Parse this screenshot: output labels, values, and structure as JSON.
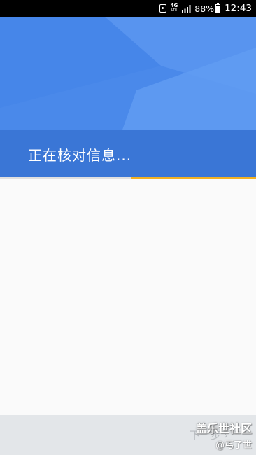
{
  "status_bar": {
    "network": "4G",
    "network_sub": "LTE",
    "battery_percent": "88%",
    "battery_level": 0.88,
    "time": "12:43"
  },
  "header": {
    "title": "正在核对信息...",
    "progress": 0.48
  },
  "footer": {
    "next_label": "下一步"
  },
  "watermark": {
    "line1": "盖乐世社区",
    "line2": "@丐了世"
  },
  "colors": {
    "header_blue": "#4a89ea",
    "title_band_blue": "#3a76d6",
    "progress_accent": "#f2b122",
    "body_bg": "#fafafa",
    "footer_bg": "#e3e6e9"
  },
  "icons": [
    "notification-icon",
    "signal-icon",
    "battery-icon",
    "chevron-right-icon"
  ]
}
